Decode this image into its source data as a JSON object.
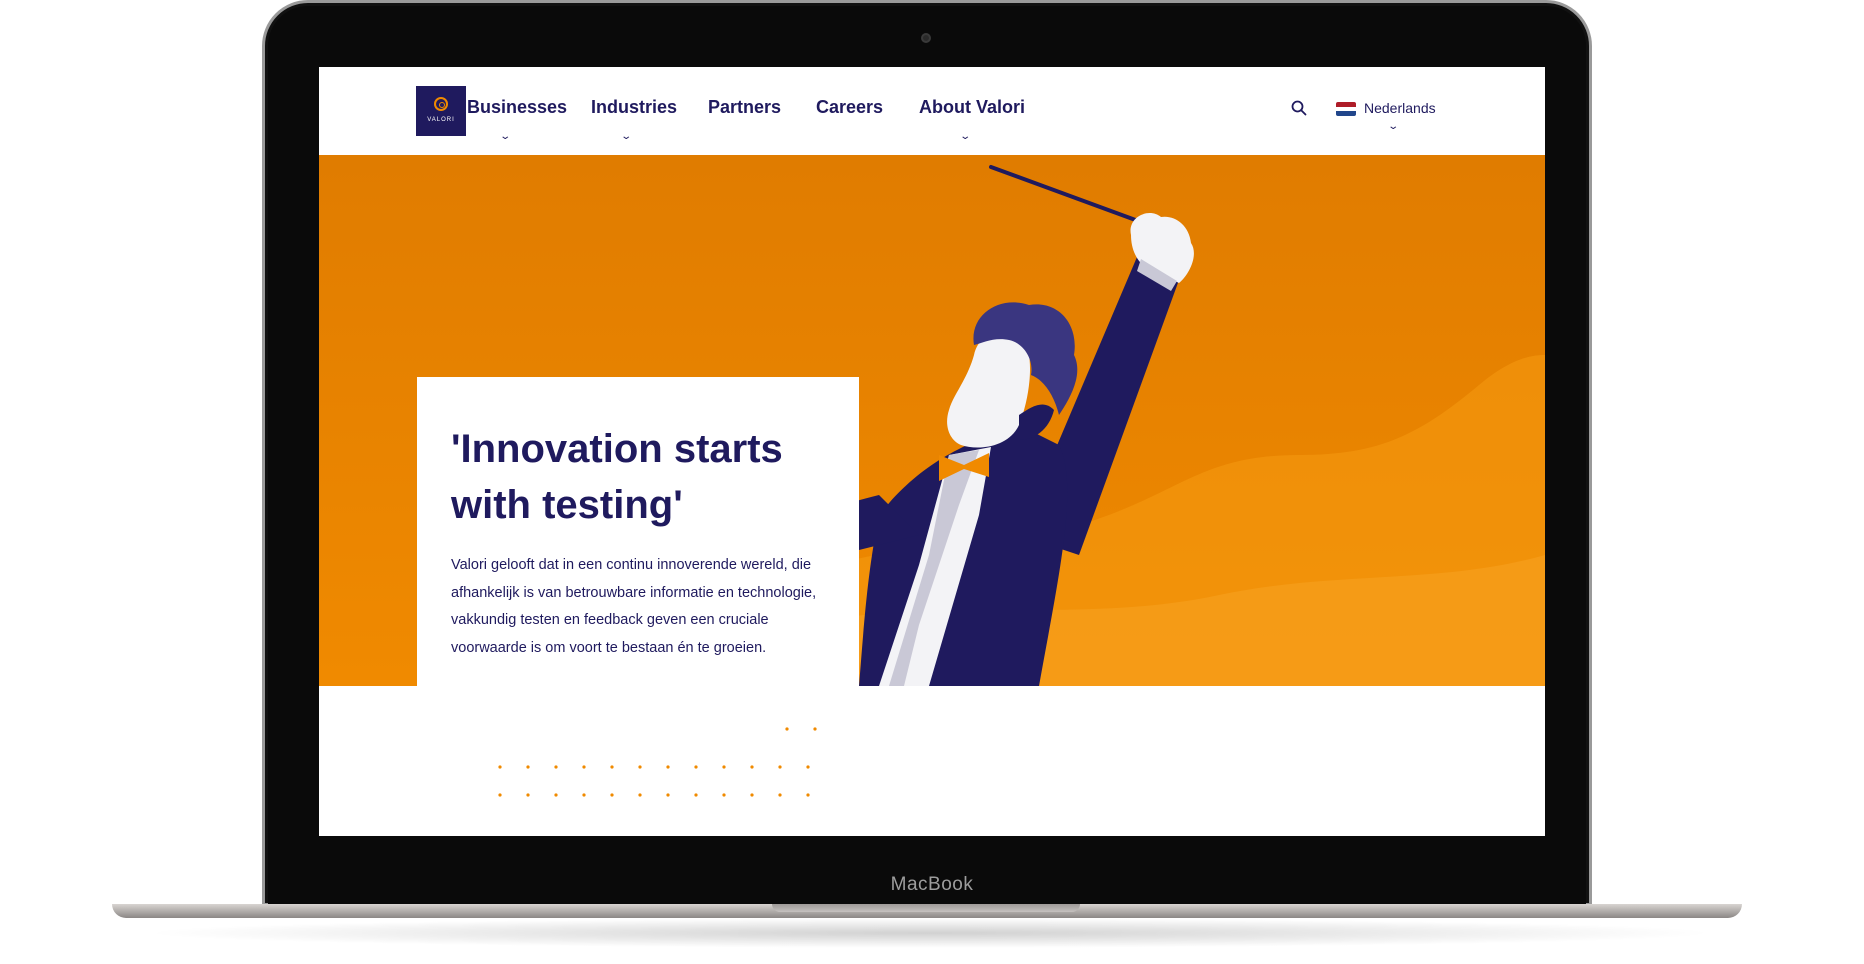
{
  "device": {
    "label": "MacBook"
  },
  "nav": {
    "logo_text": "VALORI",
    "menu": [
      {
        "label": "Businesses",
        "has_dropdown": true
      },
      {
        "label": "Industries",
        "has_dropdown": true
      },
      {
        "label": "Partners",
        "has_dropdown": false
      },
      {
        "label": "Careers",
        "has_dropdown": false
      },
      {
        "label": "About Valori",
        "has_dropdown": true
      }
    ],
    "search_icon": "search-icon",
    "language": {
      "label": "Nederlands",
      "flag": "netherlands-flag"
    }
  },
  "hero": {
    "title": "'Innovation starts with testing'",
    "body": "Valori gelooft dat in een continu innoverende wereld, die afhankelijk is van betrouwbare informatie en technologie, vakkundig testen en feedback geven een cruciale voorwaarde is om voort te bestaan én te groeien.",
    "illustration": "orchestra-conductor-illustration"
  },
  "colors": {
    "brand_navy": "#1f1a5e",
    "brand_orange": "#f08a00",
    "hero_orange_dark": "#e07c00"
  }
}
